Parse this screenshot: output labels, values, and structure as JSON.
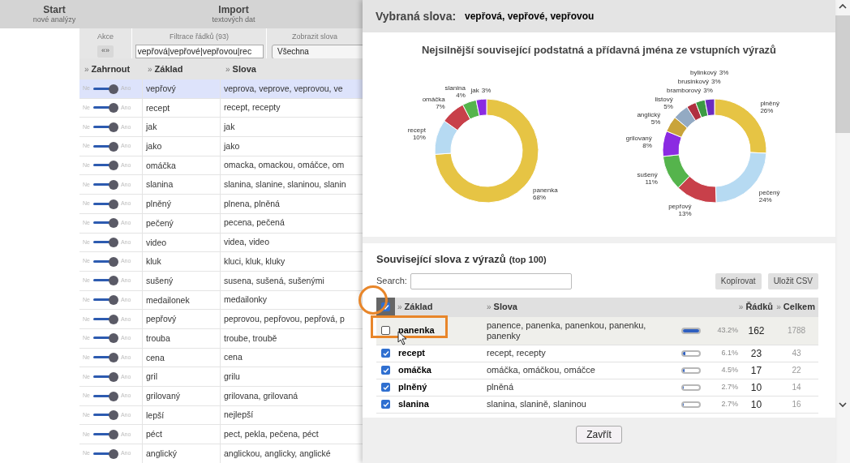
{
  "top_nav": [
    {
      "title": "Start",
      "subtitle": "nové analýzy"
    },
    {
      "title": "Import",
      "subtitle": "textových dat"
    }
  ],
  "toolbar": {
    "actions_label": "Akce",
    "actions_button": "«»",
    "filter_label": "Filtrace řádků (93)",
    "filter_value": "vepřová|vepřové|vepřovou|rec",
    "show_label": "Zobrazit slova",
    "show_value": "Všechna"
  },
  "words_table": {
    "columns": [
      {
        "marker": "»",
        "label": "Zahrnout"
      },
      {
        "marker": "»",
        "label": "Základ"
      },
      {
        "marker": "»",
        "label": "Slova"
      }
    ],
    "rows": [
      {
        "off_label": "Ne",
        "on_label": "Ano",
        "included": true,
        "selected": true,
        "base": "vepřový",
        "words": "veprova, veprove, veprovou, ve"
      },
      {
        "off_label": "Ne",
        "on_label": "Ano",
        "included": true,
        "selected": false,
        "base": "recept",
        "words": "recept, recepty"
      },
      {
        "off_label": "Ne",
        "on_label": "Ano",
        "included": true,
        "selected": false,
        "base": "jak",
        "words": "jak"
      },
      {
        "off_label": "Ne",
        "on_label": "Ano",
        "included": true,
        "selected": false,
        "base": "jako",
        "words": "jako"
      },
      {
        "off_label": "Ne",
        "on_label": "Ano",
        "included": true,
        "selected": false,
        "base": "omáčka",
        "words": "omacka, omackou, omáčce, om"
      },
      {
        "off_label": "Ne",
        "on_label": "Ano",
        "included": true,
        "selected": false,
        "base": "slanina",
        "words": "slanina, slanine, slaninou, slanin"
      },
      {
        "off_label": "Ne",
        "on_label": "Ano",
        "included": true,
        "selected": false,
        "base": "plněný",
        "words": "plnena, plněná"
      },
      {
        "off_label": "Ne",
        "on_label": "Ano",
        "included": true,
        "selected": false,
        "base": "pečený",
        "words": "pecena, pečená"
      },
      {
        "off_label": "Ne",
        "on_label": "Ano",
        "included": true,
        "selected": false,
        "base": "video",
        "words": "videa, video"
      },
      {
        "off_label": "Ne",
        "on_label": "Ano",
        "included": true,
        "selected": false,
        "base": "kluk",
        "words": "kluci, kluk, kluky"
      },
      {
        "off_label": "Ne",
        "on_label": "Ano",
        "included": true,
        "selected": false,
        "base": "sušený",
        "words": "susena, sušená, sušenými"
      },
      {
        "off_label": "Ne",
        "on_label": "Ano",
        "included": true,
        "selected": false,
        "base": "medailonek",
        "words": "medailonky"
      },
      {
        "off_label": "Ne",
        "on_label": "Ano",
        "included": true,
        "selected": false,
        "base": "pepřový",
        "words": "peprovou, pepřovou, pepřová, p"
      },
      {
        "off_label": "Ne",
        "on_label": "Ano",
        "included": true,
        "selected": false,
        "base": "trouba",
        "words": "troube, troubě"
      },
      {
        "off_label": "Ne",
        "on_label": "Ano",
        "included": true,
        "selected": false,
        "base": "cena",
        "words": "cena"
      },
      {
        "off_label": "Ne",
        "on_label": "Ano",
        "included": true,
        "selected": false,
        "base": "gril",
        "words": "grilu"
      },
      {
        "off_label": "Ne",
        "on_label": "Ano",
        "included": true,
        "selected": false,
        "base": "grilovaný",
        "words": "grilovana, grilovaná"
      },
      {
        "off_label": "Ne",
        "on_label": "Ano",
        "included": true,
        "selected": false,
        "base": "lepší",
        "words": "nejlepší"
      },
      {
        "off_label": "Ne",
        "on_label": "Ano",
        "included": true,
        "selected": false,
        "base": "péct",
        "words": "pect, pekla, pečena, péct"
      },
      {
        "off_label": "Ne",
        "on_label": "Ano",
        "included": true,
        "selected": false,
        "base": "anglický",
        "words": "anglickou, anglicky, anglické"
      }
    ]
  },
  "dialog": {
    "selected_label": "Vybraná slova:",
    "selected_words": "vepřová, vepřové, vepřovou",
    "charts_title": "Nejsilnější související podstatná a přídavná jména ze vstupních výrazů",
    "charts": [
      {
        "chart_data": {
          "type": "donut",
          "categories": [
            "panenka",
            "recept",
            "omáčka",
            "slanina",
            "jak"
          ],
          "values": [
            68,
            10,
            7,
            4,
            3
          ],
          "colors": [
            "#e6c444",
            "#b6daf2",
            "#c8404a",
            "#55b44c",
            "#8b2be2"
          ],
          "value_labels": [
            "68%",
            "10%",
            "7%",
            "4%",
            "3%"
          ]
        }
      },
      {
        "chart_data": {
          "type": "donut",
          "categories": [
            "plněný",
            "pečený",
            "pepřový",
            "sušený",
            "grilovaný",
            "anglický",
            "listový",
            "bramborový",
            "brusinkový",
            "bylinkový"
          ],
          "values": [
            26,
            24,
            13,
            11,
            8,
            5,
            5,
            3,
            3,
            3
          ],
          "colors": [
            "#e6c444",
            "#b6daf2",
            "#c8404a",
            "#55b44c",
            "#8b2be2",
            "#c9a43a",
            "#93aac3",
            "#b03040",
            "#3c9a44",
            "#6b2bc0"
          ],
          "value_labels": [
            "26%",
            "24%",
            "13%",
            "11%",
            "8%",
            "5%",
            "5%",
            "3%",
            "3%",
            "3%"
          ]
        }
      }
    ],
    "related": {
      "title": "Související slova z výrazů",
      "title_note": "(top 100)",
      "search_label": "Search:",
      "buttons": [
        "Kopírovat",
        "Uložit CSV"
      ],
      "header_checked": true,
      "columns": [
        {
          "marker": "»",
          "label": "Základ"
        },
        {
          "marker": "»",
          "label": "Slova"
        },
        {
          "marker": "»",
          "label": "Řádků"
        },
        {
          "marker": "»",
          "label": "Celkem"
        }
      ],
      "rows": [
        {
          "checked": false,
          "hovered": true,
          "base": "panenka",
          "words": "panence, panenka, panenkou, panenku, panenky",
          "level": 1,
          "percent": "43.2%",
          "rows": "162",
          "total": "1788"
        },
        {
          "checked": true,
          "hovered": false,
          "base": "recept",
          "words": "recept, recepty",
          "level": 0.14,
          "percent": "6.1%",
          "rows": "23",
          "total": "43"
        },
        {
          "checked": true,
          "hovered": false,
          "base": "omáčka",
          "words": "omáčka, omáčkou, omáčce",
          "level": 0.1,
          "percent": "4.5%",
          "rows": "17",
          "total": "22"
        },
        {
          "checked": true,
          "hovered": false,
          "base": "plněný",
          "words": "plněná",
          "level": 0.06,
          "percent": "2.7%",
          "rows": "10",
          "total": "14"
        },
        {
          "checked": true,
          "hovered": false,
          "base": "slanina",
          "words": "slanina, slanině, slaninou",
          "level": 0.06,
          "percent": "2.7%",
          "rows": "10",
          "total": "16"
        }
      ]
    },
    "close_button": "Zavřít"
  }
}
